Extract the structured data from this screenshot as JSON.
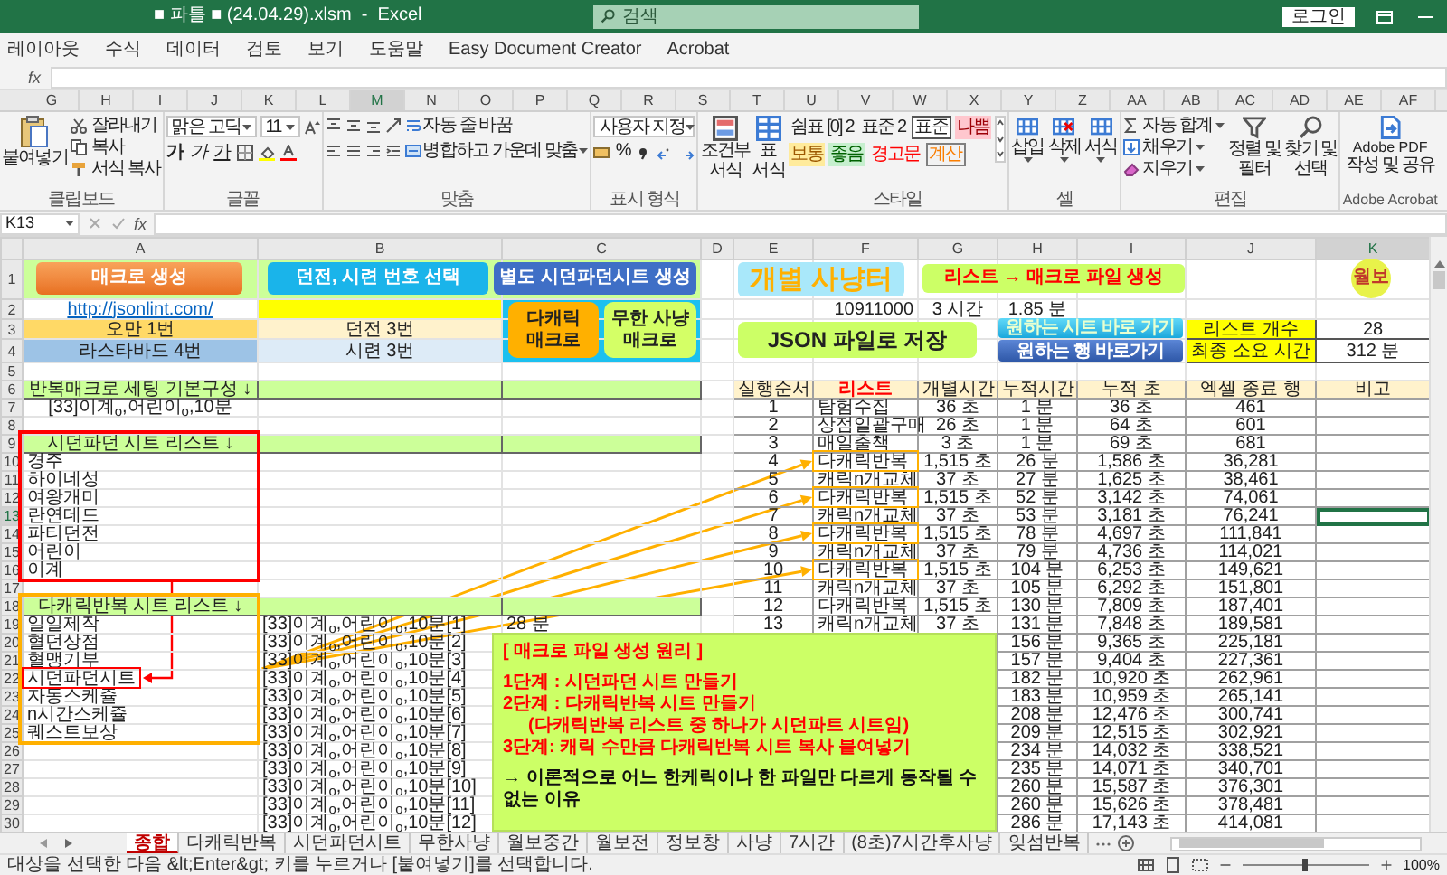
{
  "title_bar": {
    "title": "■ 파틀 ■ (24.04.29).xlsm  -  Excel",
    "search_placeholder": "검색",
    "login": "로그인"
  },
  "menu": [
    "레이아웃",
    "수식",
    "데이터",
    "검토",
    "보기",
    "도움말",
    "Easy Document Creator",
    "Acrobat"
  ],
  "formula_bar_top": {
    "function_label": "fx"
  },
  "column_strip": [
    {
      "label": "G",
      "selected": false
    },
    {
      "label": "H",
      "selected": false
    },
    {
      "label": "I",
      "selected": false
    },
    {
      "label": "J",
      "selected": false
    },
    {
      "label": "K",
      "selected": false
    },
    {
      "label": "L",
      "selected": false
    },
    {
      "label": "M",
      "selected": true
    },
    {
      "label": "N",
      "selected": false
    },
    {
      "label": "O",
      "selected": false
    },
    {
      "label": "P",
      "selected": false
    },
    {
      "label": "Q",
      "selected": false
    },
    {
      "label": "R",
      "selected": false
    },
    {
      "label": "S",
      "selected": false
    },
    {
      "label": "T",
      "selected": false
    },
    {
      "label": "U",
      "selected": false
    },
    {
      "label": "V",
      "selected": false
    },
    {
      "label": "W",
      "selected": false
    },
    {
      "label": "X",
      "selected": false
    },
    {
      "label": "Y",
      "selected": false
    },
    {
      "label": "Z",
      "selected": false
    },
    {
      "label": "AA",
      "selected": false
    },
    {
      "label": "AB",
      "selected": false
    },
    {
      "label": "AC",
      "selected": false
    },
    {
      "label": "AD",
      "selected": false
    },
    {
      "label": "AE",
      "selected": false
    },
    {
      "label": "AF",
      "selected": false
    }
  ],
  "ribbon": {
    "clipboard": {
      "paste": "붙여넣기",
      "cut": "잘라내기",
      "copy": "복사",
      "format_painter": "서식 복사",
      "label": "클립보드"
    },
    "font": {
      "name": "맑은 고딕",
      "size": "11",
      "style_buttons": [
        "가",
        "가",
        "가"
      ],
      "label": "글꼴"
    },
    "alignment": {
      "wrap": "자동 줄 바꿈",
      "merge": "병합하고 가운데 맞춤",
      "label": "맞춤"
    },
    "number": {
      "format": "사용자 지정",
      "percent": "%",
      "label": "표시 형식"
    },
    "conditional_format": [
      "조건부",
      "서식"
    ],
    "table_format": [
      "표",
      "서식"
    ],
    "styles": {
      "items": [
        {
          "text": "쉼표 [0] 2",
          "kind": "plain"
        },
        {
          "text": "표준 2",
          "kind": "plain"
        },
        {
          "text": "표준",
          "kind": "framed"
        },
        {
          "text": "나쁨",
          "kind": "bad"
        },
        {
          "text": "보통",
          "kind": "neutral"
        },
        {
          "text": "좋음",
          "kind": "good"
        },
        {
          "text": "경고문",
          "kind": "warning"
        },
        {
          "text": "계산",
          "kind": "calc"
        }
      ],
      "label": "스타일"
    },
    "cells": {
      "items": [
        "삽입",
        "삭제",
        "서식"
      ],
      "label": "셀"
    },
    "editing": {
      "autosum": "자동 합계",
      "fill": "채우기",
      "clear": "지우기",
      "sort": [
        "정렬 및",
        "필터"
      ],
      "find": [
        "찾기 및",
        "선택"
      ],
      "label": "편집"
    },
    "acrobat": {
      "button": [
        "Adobe PDF",
        "작성 및 공유"
      ],
      "label": "Adobe Acrobat"
    }
  },
  "formula_bar": {
    "name_box": "K13",
    "function_label": "fx"
  },
  "sheet": {
    "columns": [
      {
        "label": "A",
        "selected": false
      },
      {
        "label": "B",
        "selected": false
      },
      {
        "label": "C",
        "selected": false
      },
      {
        "label": "D",
        "selected": false
      },
      {
        "label": "E",
        "selected": false
      },
      {
        "label": "F",
        "selected": false
      },
      {
        "label": "G",
        "selected": false
      },
      {
        "label": "H",
        "selected": false
      },
      {
        "label": "I",
        "selected": false
      },
      {
        "label": "J",
        "selected": false
      },
      {
        "label": "K",
        "selected": true
      }
    ],
    "rows": [
      {
        "label": "1",
        "selected": false
      },
      {
        "label": "2",
        "selected": false
      },
      {
        "label": "3",
        "selected": false
      },
      {
        "label": "4",
        "selected": false
      },
      {
        "label": "5",
        "selected": false
      },
      {
        "label": "6",
        "selected": false
      },
      {
        "label": "7",
        "selected": false
      },
      {
        "label": "8",
        "selected": false
      },
      {
        "label": "9",
        "selected": false
      },
      {
        "label": "10",
        "selected": false
      },
      {
        "label": "11",
        "selected": false
      },
      {
        "label": "12",
        "selected": false
      },
      {
        "label": "13",
        "selected": true
      },
      {
        "label": "14",
        "selected": false
      },
      {
        "label": "15",
        "selected": false
      },
      {
        "label": "16",
        "selected": false
      },
      {
        "label": "17",
        "selected": false
      },
      {
        "label": "18",
        "selected": false
      },
      {
        "label": "19",
        "selected": false
      },
      {
        "label": "20",
        "selected": false
      },
      {
        "label": "21",
        "selected": false
      },
      {
        "label": "22",
        "selected": false
      },
      {
        "label": "23",
        "selected": false
      },
      {
        "label": "24",
        "selected": false
      },
      {
        "label": "25",
        "selected": false
      },
      {
        "label": "26",
        "selected": false
      },
      {
        "label": "27",
        "selected": false
      },
      {
        "label": "28",
        "selected": false
      },
      {
        "label": "29",
        "selected": false
      },
      {
        "label": "30",
        "selected": false
      }
    ],
    "top_buttons": [
      {
        "label": "매크로 생성",
        "kind": "orange"
      },
      {
        "label": "던전, 시련 번호 선택",
        "kind": "cyan"
      },
      {
        "label": "별도 시던파던시트 생성",
        "kind": "blue"
      }
    ],
    "link": "http://jsonlint.com/",
    "selectors": [
      {
        "left": "오만 1번",
        "right": "던전 3번"
      },
      {
        "left": "라스타바드 4번",
        "right": "시련 3번"
      }
    ],
    "macro_buttons": [
      {
        "lines": [
          "다캐릭",
          "매크로"
        ],
        "kind": "orange"
      },
      {
        "lines": [
          "무한 사냥",
          "매크로"
        ],
        "kind": "lime"
      }
    ],
    "hunting_title": "개별 사냥터",
    "generate_label": "리스트 → 매크로 파일 생성",
    "badge": "월보",
    "stats": [
      "10911000",
      "3 시간",
      "1.85 분"
    ],
    "json_button": "JSON 파일로 저장",
    "nav_buttons": [
      "원하는 시트 바로 가기",
      "원하는 행 바로가기"
    ],
    "summary": [
      {
        "label": "리스트 개수",
        "value": "28"
      },
      {
        "label": "최종 소요 시간",
        "value": "312 분"
      }
    ],
    "left_lists": [
      {
        "title": "반복매크로 세팅 기본구성 ↓",
        "kind": "setting",
        "items": [
          {
            "text": "[33]이계$_{o}$,어린이$_{o}$,10분",
            "highlighted": false
          }
        ]
      },
      {
        "title": "시던파던 시트 리스트 ↓",
        "kind": "list",
        "color": "#ff0000",
        "items": [
          {
            "text": "경주",
            "highlighted": false
          },
          {
            "text": "하이네성",
            "highlighted": false
          },
          {
            "text": "여왕개미",
            "highlighted": false
          },
          {
            "text": "란연데드",
            "highlighted": false
          },
          {
            "text": "파티던전",
            "highlighted": false
          },
          {
            "text": "어린이",
            "highlighted": false
          },
          {
            "text": "이계",
            "highlighted": false
          }
        ]
      },
      {
        "title": "다캐릭반복 시트 리스트 ↓",
        "kind": "list",
        "color": "#ffb000",
        "items": [
          {
            "text": "일일제작",
            "highlighted": false
          },
          {
            "text": "혈던상점",
            "highlighted": false
          },
          {
            "text": "혈맹기부",
            "highlighted": false
          },
          {
            "text": "시던파던시트",
            "highlighted": true
          },
          {
            "text": "자동스케쥴",
            "highlighted": false
          },
          {
            "text": "n시간스케쥴",
            "highlighted": false
          },
          {
            "text": "퀘스트보상",
            "highlighted": false
          }
        ]
      }
    ],
    "macro_files": [
      {
        "name": "[33]이계$_{o}$,어린이$_{o}$,10분[1]",
        "duration": "28 분"
      },
      {
        "name": "[33]이계$_{o}$,어린이$_{o}$,10분[2]"
      },
      {
        "name": "[33]이계$_{o}$,어린이$_{o}$,10분[3]"
      },
      {
        "name": "[33]이계$_{o}$,어린이$_{o}$,10분[4]"
      },
      {
        "name": "[33]이계$_{o}$,어린이$_{o}$,10분[5]"
      },
      {
        "name": "[33]이계$_{o}$,어린이$_{o}$,10분[6]"
      },
      {
        "name": "[33]이계$_{o}$,어린이$_{o}$,10분[7]"
      },
      {
        "name": "[33]이계$_{o}$,어린이$_{o}$,10분[8]"
      },
      {
        "name": "[33]이계$_{o}$,어린이$_{o}$,10분[9]"
      },
      {
        "name": "[33]이계$_{o}$,어린이$_{o}$,10분[10]"
      },
      {
        "name": "[33]이계$_{o}$,어린이$_{o}$,10분[11]"
      },
      {
        "name": "[33]이계$_{o}$,어린이$_{o}$,10분[12]"
      }
    ],
    "run_table": {
      "headers": [
        {
          "text": "실행순서",
          "kind": "plain"
        },
        {
          "text": "리스트",
          "kind": "accent"
        },
        {
          "text": "개별시간",
          "kind": "plain"
        },
        {
          "text": "누적시간",
          "kind": "plain"
        },
        {
          "text": "누적 초",
          "kind": "plain"
        },
        {
          "text": "엑셀 종료 행",
          "kind": "plain"
        },
        {
          "text": "비고",
          "kind": "plain"
        }
      ],
      "rows": [
        {
          "order": "1",
          "list": "탐험수집",
          "each": "36 초",
          "time": "1 분",
          "total": "36 초",
          "end_row": "461",
          "highlighted": false
        },
        {
          "order": "2",
          "list": "상점일괄구매",
          "each": "26 초",
          "time": "1 분",
          "total": "64 초",
          "end_row": "601",
          "highlighted": false
        },
        {
          "order": "3",
          "list": "매일출책",
          "each": "3 초",
          "time": "1 분",
          "total": "69 초",
          "end_row": "681",
          "highlighted": false
        },
        {
          "order": "4",
          "list": "다캐릭반복",
          "each": "1,515 초",
          "time": "26 분",
          "total": "1,586 초",
          "end_row": "36,281",
          "highlighted": true
        },
        {
          "order": "5",
          "list": "캐릭n개교체",
          "each": "37 초",
          "time": "27 분",
          "total": "1,625 초",
          "end_row": "38,461",
          "highlighted": false
        },
        {
          "order": "6",
          "list": "다캐릭반복",
          "each": "1,515 초",
          "time": "52 분",
          "total": "3,142 초",
          "end_row": "74,061",
          "highlighted": true
        },
        {
          "order": "7",
          "list": "캐릭n개교체",
          "each": "37 초",
          "time": "53 분",
          "total": "3,181 초",
          "end_row": "76,241",
          "highlighted": false
        },
        {
          "order": "8",
          "list": "다캐릭반복",
          "each": "1,515 초",
          "time": "78 분",
          "total": "4,697 초",
          "end_row": "111,841",
          "highlighted": true
        },
        {
          "order": "9",
          "list": "캐릭n개교체",
          "each": "37 초",
          "time": "79 분",
          "total": "4,736 초",
          "end_row": "114,021",
          "highlighted": false
        },
        {
          "order": "10",
          "list": "다캐릭반복",
          "each": "1,515 초",
          "time": "104 분",
          "total": "6,253 초",
          "end_row": "149,621",
          "highlighted": true
        },
        {
          "order": "11",
          "list": "캐릭n개교체",
          "each": "37 초",
          "time": "105 분",
          "total": "6,292 초",
          "end_row": "151,801",
          "highlighted": false
        },
        {
          "order": "12",
          "list": "다캐릭반복",
          "each": "1,515 초",
          "time": "130 분",
          "total": "7,809 초",
          "end_row": "187,401",
          "highlighted": false
        },
        {
          "order": "13",
          "list": "캐릭n개교체",
          "each": "37 초",
          "time": "131 분",
          "total": "7,848 초",
          "end_row": "189,581",
          "highlighted": false
        },
        {
          "time": "156 분",
          "total": "9,365 초",
          "end_row": "225,181",
          "highlighted": false
        },
        {
          "time": "157 분",
          "total": "9,404 초",
          "end_row": "227,361",
          "highlighted": false
        },
        {
          "time": "182 분",
          "total": "10,920 초",
          "end_row": "262,961",
          "highlighted": false
        },
        {
          "time": "183 분",
          "total": "10,959 초",
          "end_row": "265,141",
          "highlighted": false
        },
        {
          "time": "208 분",
          "total": "12,476 초",
          "end_row": "300,741",
          "highlighted": false
        },
        {
          "time": "209 분",
          "total": "12,515 초",
          "end_row": "302,921",
          "highlighted": false
        },
        {
          "time": "234 분",
          "total": "14,032 초",
          "end_row": "338,521",
          "highlighted": false
        },
        {
          "time": "235 분",
          "total": "14,071 초",
          "end_row": "340,701",
          "highlighted": false
        },
        {
          "time": "260 분",
          "total": "15,587 초",
          "end_row": "376,301",
          "highlighted": false
        },
        {
          "time": "260 분",
          "total": "15,626 초",
          "end_row": "378,481",
          "highlighted": false
        },
        {
          "time": "286 분",
          "total": "17,143 초",
          "end_row": "414,081",
          "highlighted": false
        }
      ]
    },
    "note": {
      "title": "[ 매크로 파일 생성 원리 ]",
      "steps": [
        {
          "text": "1단계 : 시던파던 시트 만들기",
          "kind": "step"
        },
        {
          "text": "2단계 : 다캐릭반복 시트 만들기",
          "kind": "step"
        },
        {
          "text": "(다캐릭반복 리스트 중 하나가 시던파트 시트임)",
          "kind": "detail"
        },
        {
          "text": "3단계: 캐릭 수만큼 다캐릭반복 시트 복사 붙여넣기",
          "kind": "step"
        }
      ],
      "conclusion": "→ 이론적으로 어느 한케릭이나 한 파일만 다르게 동작될 수 없는 이유"
    }
  },
  "sheet_tabs": [
    {
      "label": "종합",
      "selected": true
    },
    {
      "label": "다캐릭반복",
      "selected": false
    },
    {
      "label": "시던파던시트",
      "selected": false
    },
    {
      "label": "무한사냥",
      "selected": false
    },
    {
      "label": "월보중간",
      "selected": false
    },
    {
      "label": "월보전",
      "selected": false
    },
    {
      "label": "정보창",
      "selected": false
    },
    {
      "label": "사냥",
      "selected": false
    },
    {
      "label": "7시간",
      "selected": false
    },
    {
      "label": "(8초)7시간후사냥",
      "selected": false
    },
    {
      "label": "잊섬반복",
      "selected": false
    }
  ],
  "status_bar": {
    "message": "대상을 선택한 다음 &lt;Enter&gt; 키를 누르거나 [붙여넣기]를 선택합니다.",
    "zoom": {
      "level": 0.5,
      "reading": "100%"
    }
  }
}
